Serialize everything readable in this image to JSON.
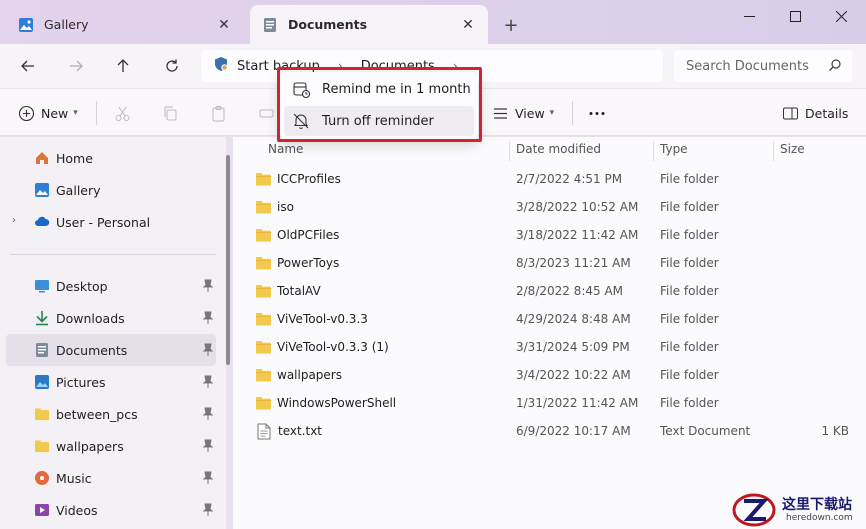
{
  "tabs": [
    {
      "label": "Gallery",
      "icon": "gallery-icon",
      "active": false
    },
    {
      "label": "Documents",
      "icon": "documents-folder-icon",
      "active": true
    }
  ],
  "address": {
    "crumbs": [
      "Start backup",
      "Documents"
    ],
    "search_placeholder": "Search Documents"
  },
  "commands": {
    "new_label": "New",
    "view_label": "View",
    "details_label": "Details"
  },
  "nav": {
    "items": [
      {
        "label": "Home",
        "icon": "home-icon"
      },
      {
        "label": "Gallery",
        "icon": "gallery-icon"
      },
      {
        "label": "User - Personal",
        "icon": "onedrive-cloud-icon"
      },
      {
        "label": "Desktop",
        "icon": "desktop-icon"
      },
      {
        "label": "Downloads",
        "icon": "download-arrow-icon"
      },
      {
        "label": "Documents",
        "icon": "document-icon"
      },
      {
        "label": "Pictures",
        "icon": "pictures-icon"
      },
      {
        "label": "between_pcs",
        "icon": "folder-icon"
      },
      {
        "label": "wallpapers",
        "icon": "folder-icon"
      },
      {
        "label": "Music",
        "icon": "music-icon"
      },
      {
        "label": "Videos",
        "icon": "videos-icon"
      }
    ]
  },
  "columns": [
    "Name",
    "Date modified",
    "Type",
    "Size"
  ],
  "files": [
    {
      "name": "ICCProfiles",
      "date": "2/7/2022 4:51 PM",
      "type": "File folder",
      "size": "",
      "kind": "folder"
    },
    {
      "name": "iso",
      "date": "3/28/2022 10:52 AM",
      "type": "File folder",
      "size": "",
      "kind": "folder"
    },
    {
      "name": "OldPCFiles",
      "date": "3/18/2022 11:42 AM",
      "type": "File folder",
      "size": "",
      "kind": "folder"
    },
    {
      "name": "PowerToys",
      "date": "8/3/2023 11:21 AM",
      "type": "File folder",
      "size": "",
      "kind": "folder"
    },
    {
      "name": "TotalAV",
      "date": "2/8/2022 8:45 AM",
      "type": "File folder",
      "size": "",
      "kind": "folder"
    },
    {
      "name": "ViVeTool-v0.3.3",
      "date": "4/29/2024 8:48 AM",
      "type": "File folder",
      "size": "",
      "kind": "folder"
    },
    {
      "name": "ViVeTool-v0.3.3 (1)",
      "date": "3/31/2024 5:09 PM",
      "type": "File folder",
      "size": "",
      "kind": "folder"
    },
    {
      "name": "wallpapers",
      "date": "3/4/2022 10:22 AM",
      "type": "File folder",
      "size": "",
      "kind": "folder"
    },
    {
      "name": "WindowsPowerShell",
      "date": "1/31/2022 11:42 AM",
      "type": "File folder",
      "size": "",
      "kind": "folder"
    },
    {
      "name": "text.txt",
      "date": "6/9/2022 10:17 AM",
      "type": "Text Document",
      "size": "1 KB",
      "kind": "file"
    }
  ],
  "popup": {
    "items": [
      {
        "label": "Remind me in 1 month",
        "icon": "calendar-reminder-icon"
      },
      {
        "label": "Turn off reminder",
        "icon": "bell-off-icon"
      }
    ]
  },
  "watermark": {
    "line1": "这里下载站",
    "line2": "heredown.com"
  },
  "colors": {
    "folder": "#f2c94c",
    "highlight": "#d02430",
    "accent": "#0067c0"
  }
}
